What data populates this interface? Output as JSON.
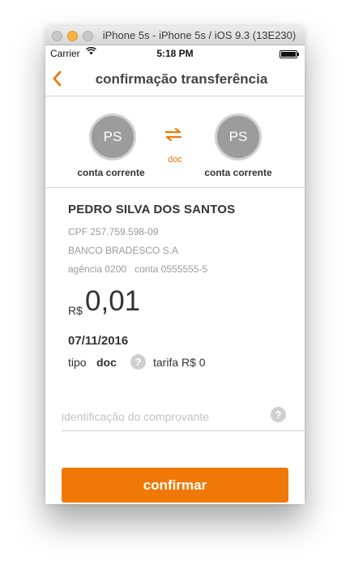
{
  "window": {
    "title": "iPhone 5s - iPhone 5s / iOS 9.3 (13E230)"
  },
  "status_bar": {
    "carrier": "Carrier",
    "time": "5:18 PM"
  },
  "nav": {
    "title": "confirmação transferência"
  },
  "accounts": {
    "from": {
      "initials": "PS",
      "label": "conta corrente"
    },
    "to": {
      "initials": "PS",
      "label": "conta corrente"
    },
    "transfer_type": "doc"
  },
  "recipient": {
    "name": "PEDRO SILVA DOS SANTOS",
    "cpf": "CPF 257.759.598-09",
    "bank": "BANCO BRADESCO S.A",
    "agency_account": "agência 0200   conta 0555555-5"
  },
  "transfer": {
    "currency": "R$",
    "amount": "0,01",
    "date": "07/11/2016",
    "type_label": "tipo",
    "type_value": "doc",
    "fee": "tarifa R$ 0"
  },
  "receipt_field": {
    "placeholder": "identificação do comprovante",
    "value": ""
  },
  "actions": {
    "confirm_label": "confirmar"
  },
  "colors": {
    "accent": "#ef7808",
    "avatar": "#9c9c9c"
  },
  "icons": {
    "back": "chevron-left-icon",
    "swap": "swap-arrows-icon",
    "help": "question-icon",
    "wifi": "wifi-icon",
    "battery": "battery-icon"
  }
}
